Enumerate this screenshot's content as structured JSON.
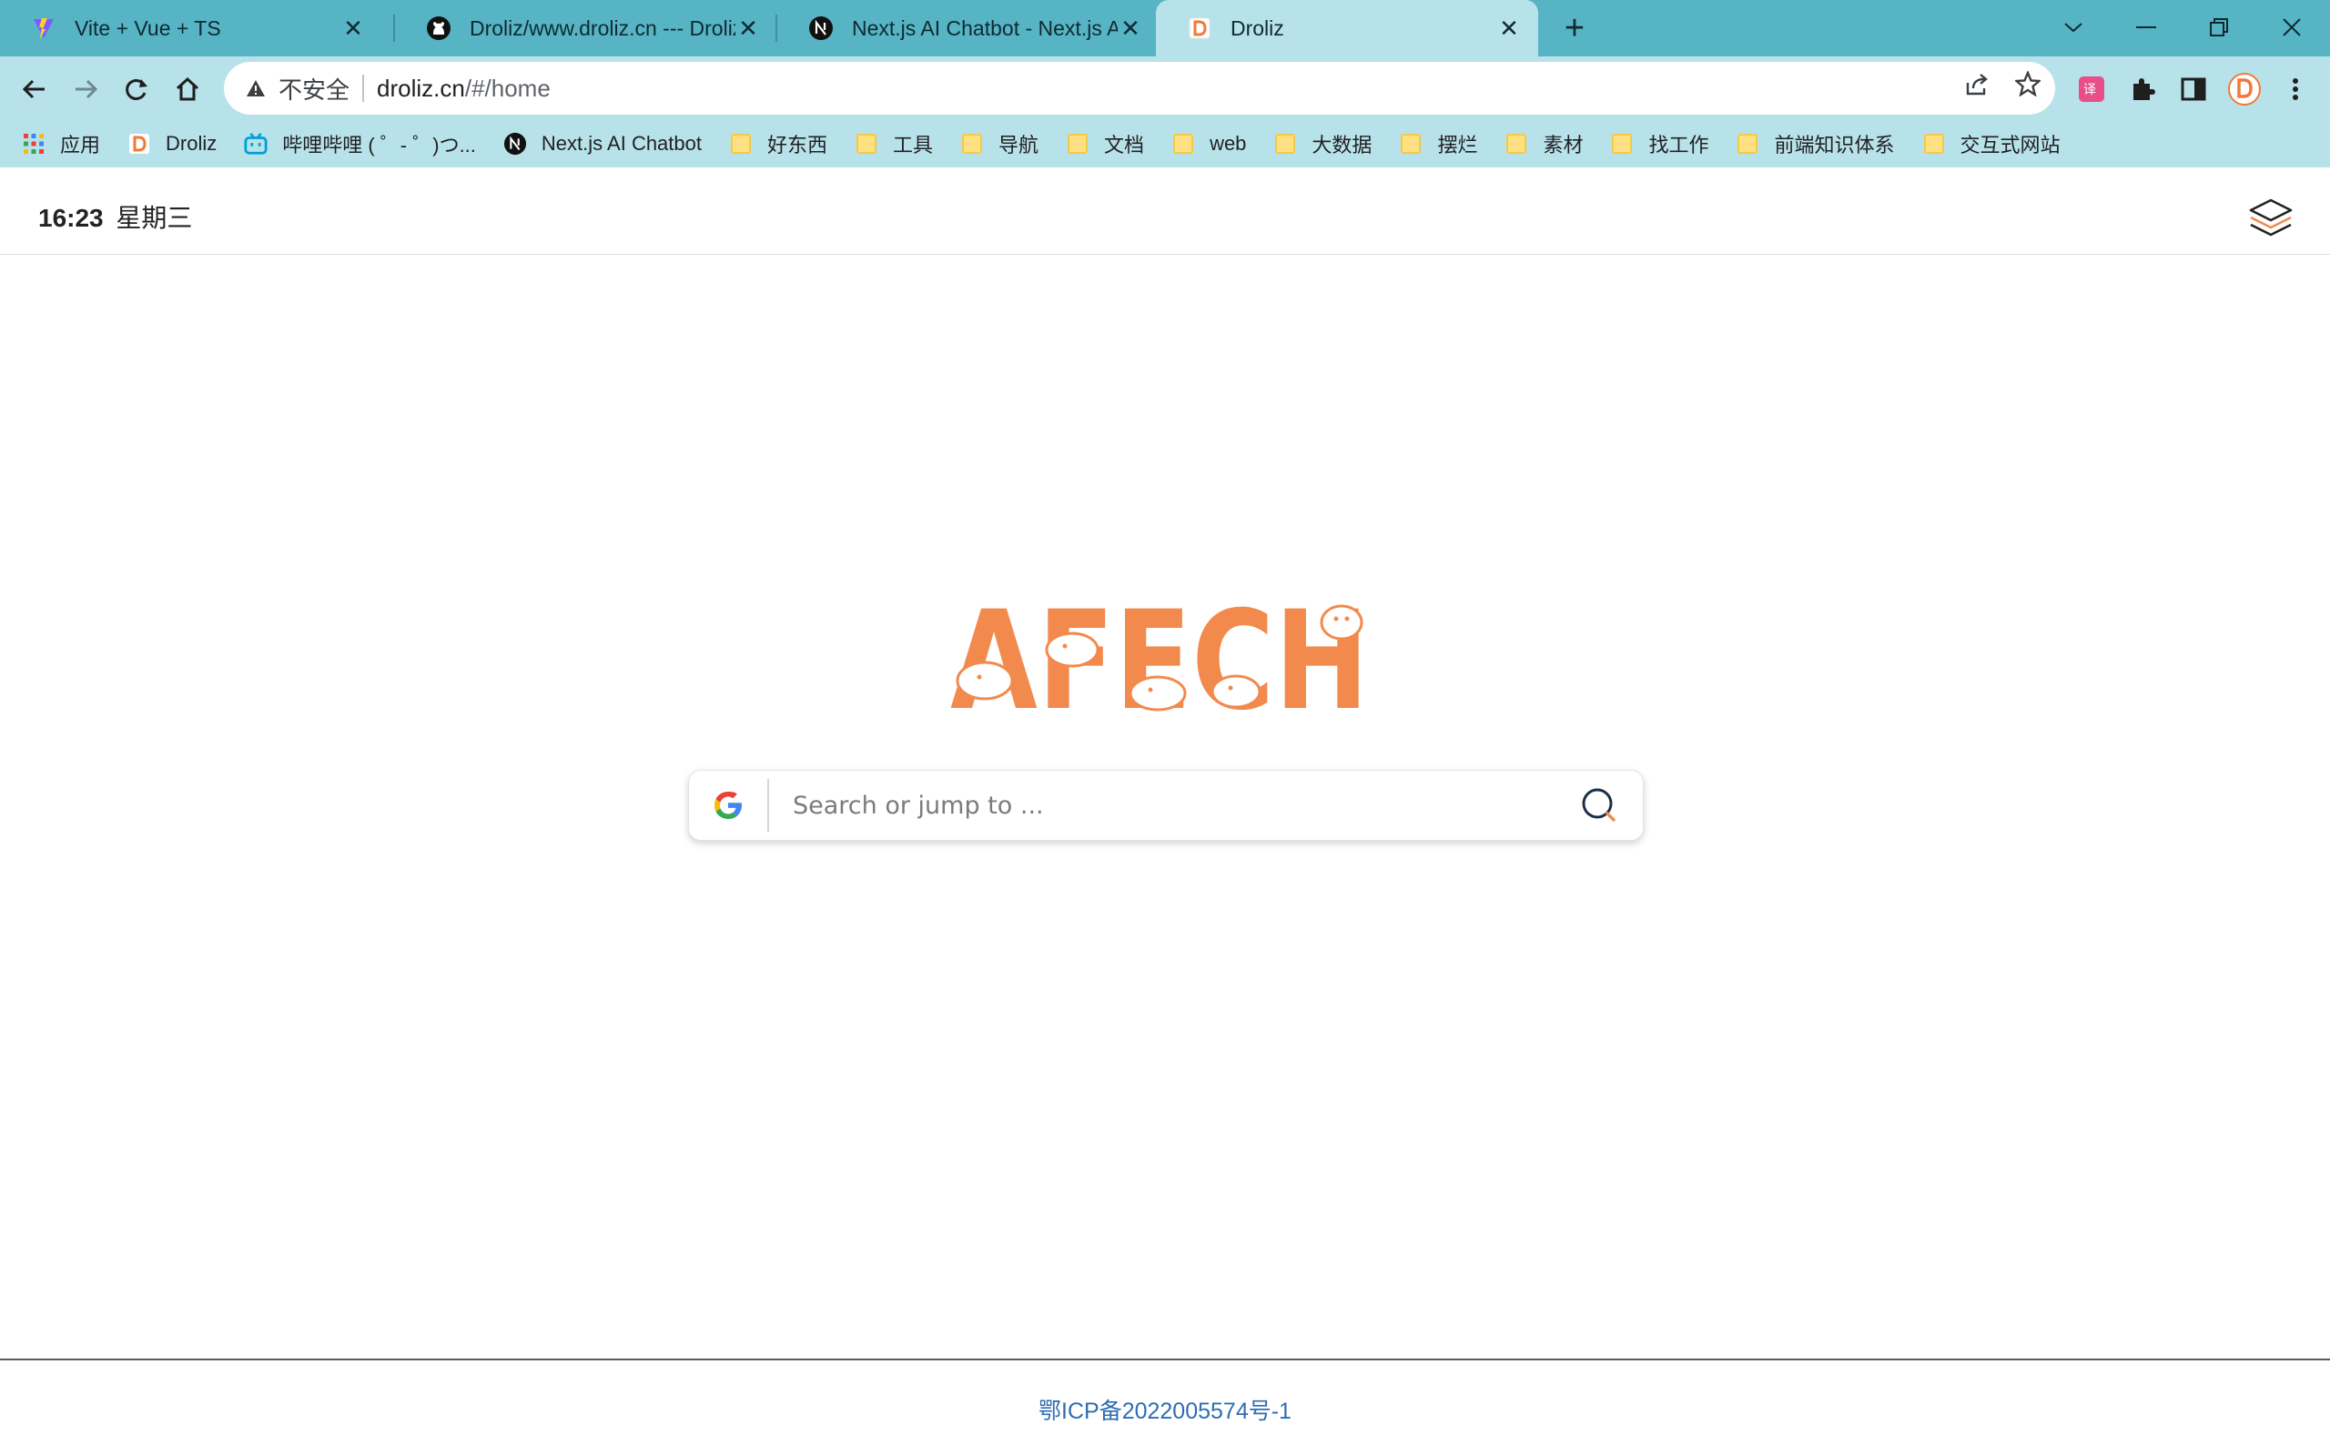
{
  "browser": {
    "tabs": [
      {
        "title": "Vite + Vue + TS",
        "favicon": "vite-icon",
        "active": false
      },
      {
        "title": "Droliz/www.droliz.cn --- Droliz",
        "favicon": "github-icon",
        "active": false
      },
      {
        "title": "Next.js AI Chatbot - Next.js AI",
        "favicon": "nextjs-icon",
        "active": false
      },
      {
        "title": "Droliz",
        "favicon": "droliz-icon",
        "active": true
      }
    ],
    "tab_close_glyph": "✕",
    "new_tab_glyph": "+",
    "address": {
      "security_label": "不安全",
      "host": "droliz.cn",
      "path": "/#/home"
    },
    "bookmarks": [
      {
        "label": "应用",
        "icon": "apps-grid-icon"
      },
      {
        "label": "Droliz",
        "icon": "droliz-icon"
      },
      {
        "label": "哔哩哔哩 ( ゜- ゜)つ...",
        "icon": "bilibili-icon"
      },
      {
        "label": "Next.js AI Chatbot",
        "icon": "nextjs-icon"
      },
      {
        "label": "好东西",
        "icon": "folder-icon"
      },
      {
        "label": "工具",
        "icon": "folder-icon"
      },
      {
        "label": "导航",
        "icon": "folder-icon"
      },
      {
        "label": "文档",
        "icon": "folder-icon"
      },
      {
        "label": "web",
        "icon": "folder-icon"
      },
      {
        "label": "大数据",
        "icon": "folder-icon"
      },
      {
        "label": "摆烂",
        "icon": "folder-icon"
      },
      {
        "label": "素材",
        "icon": "folder-icon"
      },
      {
        "label": "找工作",
        "icon": "folder-icon"
      },
      {
        "label": "前端知识体系",
        "icon": "folder-icon"
      },
      {
        "label": "交互式网站",
        "icon": "folder-icon"
      }
    ],
    "colors": {
      "chrome": "#56b4c5",
      "toolbar": "#b8e2e9"
    }
  },
  "page": {
    "clock": {
      "time": "16:23",
      "weekday": "星期三"
    },
    "logo_text": "AFECH",
    "search": {
      "placeholder": "Search or jump to ...",
      "value": "",
      "engine": "google-icon"
    },
    "footer": {
      "icp": "鄂ICP备2022005574号-1"
    },
    "colors": {
      "logo": "#f28a4e",
      "link": "#2f6db3"
    }
  }
}
